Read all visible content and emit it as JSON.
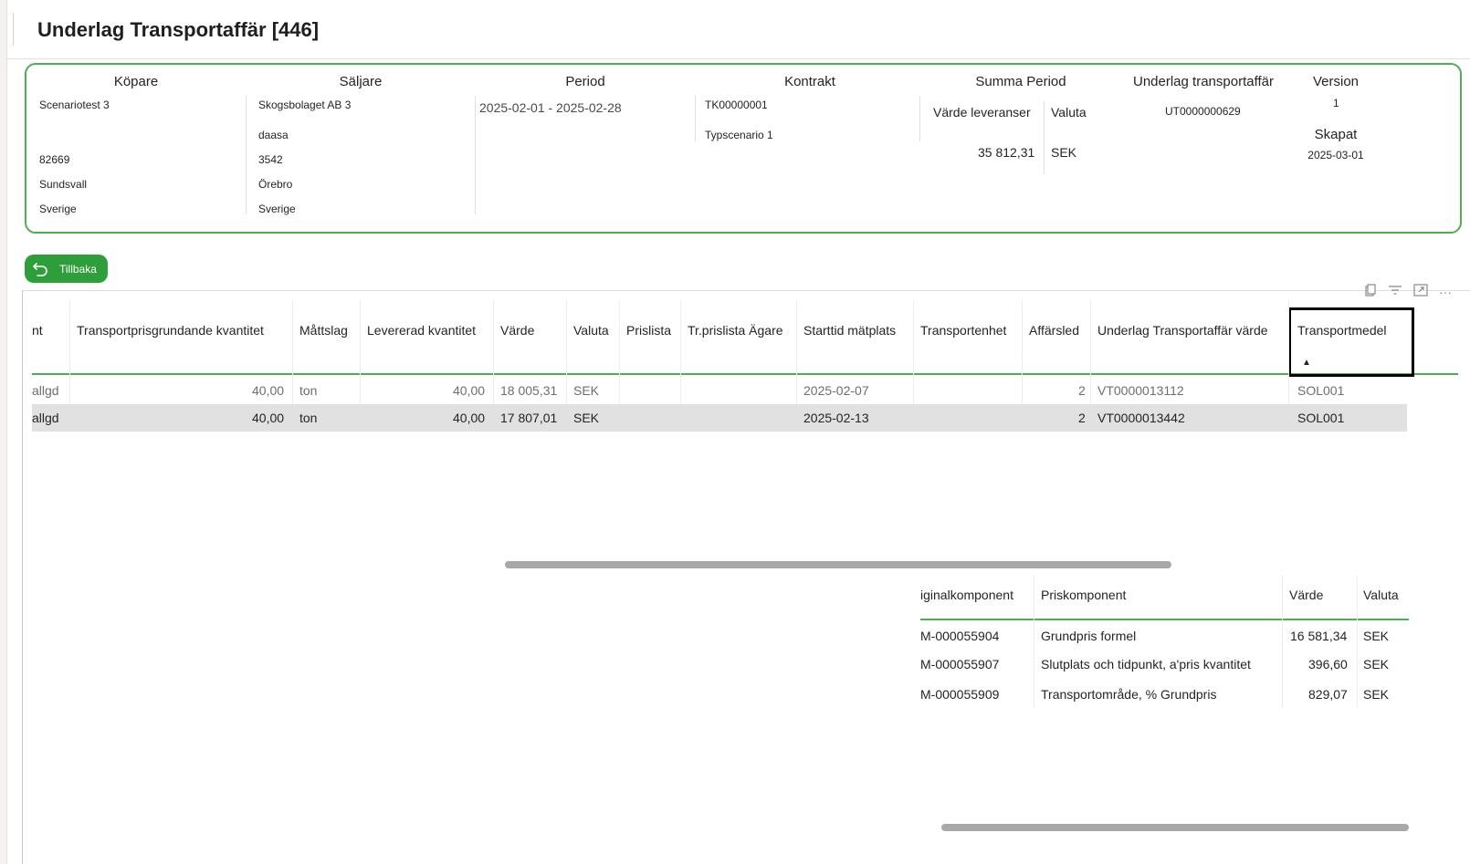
{
  "page": {
    "title": "Underlag Transportaffär [446]"
  },
  "header": {
    "kopare": {
      "label": "Köpare",
      "name": "Scenariotest 3",
      "postal": "82669",
      "city": "Sundsvall",
      "country": "Sverige"
    },
    "saljare": {
      "label": "Säljare",
      "name": "Skogsbolaget AB 3",
      "line2": "daasa",
      "postal": "3542",
      "city": "Örebro",
      "country": "Sverige"
    },
    "period": {
      "label": "Period",
      "value": "2025-02-01 - 2025-02-28"
    },
    "kontrakt": {
      "label": "Kontrakt",
      "number": "TK00000001",
      "scenario": "Typscenario 1"
    },
    "summa": {
      "label": "Summa Period",
      "col1": "Värde leveranser",
      "col2": "Valuta",
      "value": "35 812,31",
      "currency": "SEK"
    },
    "underlag": {
      "label": "Underlag transportaffär",
      "value": "UT0000000629"
    },
    "version": {
      "label": "Version",
      "value": "1",
      "created_label": "Skapat",
      "created": "2025-03-01"
    }
  },
  "back_button": {
    "label": "Tillbaka"
  },
  "main_table": {
    "columns": [
      "nt",
      "Transportprisgrundande kvantitet",
      "Måttslag",
      "Levererad kvantitet",
      "Värde",
      "Valuta",
      "Prislista",
      "Tr.prislista Ägare",
      "Starttid mätplats",
      "Transportenhet",
      "Affärsled",
      "Underlag Transportaffär värde",
      "Transportmedel"
    ],
    "rows": [
      [
        "allgd",
        "40,00",
        "ton",
        "40,00",
        "18 005,31",
        "SEK",
        "",
        "",
        "2025-02-07",
        "",
        "2",
        "VT0000013112",
        "SOL001"
      ],
      [
        "allgd",
        "40,00",
        "ton",
        "40,00",
        "17 807,01",
        "SEK",
        "",
        "",
        "2025-02-13",
        "",
        "2",
        "VT0000013442",
        "SOL001"
      ]
    ]
  },
  "sub_table": {
    "columns": [
      "iginalkomponent",
      "Priskomponent",
      "Värde",
      "Valuta"
    ],
    "rows": [
      [
        "M-000055904",
        "Grundpris formel",
        "16 581,34",
        "SEK"
      ],
      [
        "M-000055907",
        "Slutplats och tidpunkt, a'pris kvantitet",
        "396,60",
        "SEK"
      ],
      [
        "M-000055909",
        "Transportområde, % Grundpris",
        "829,07",
        "SEK"
      ]
    ]
  },
  "icons": [
    "back-arrow-icon",
    "copy-icon",
    "filter-icon",
    "focus-mode-icon",
    "more-options-icon",
    "sort-ascending-icon"
  ],
  "colors": {
    "accent_green": "#4caf50",
    "button_green": "#2e9e3a",
    "selected_row": "#e1e1e1"
  }
}
